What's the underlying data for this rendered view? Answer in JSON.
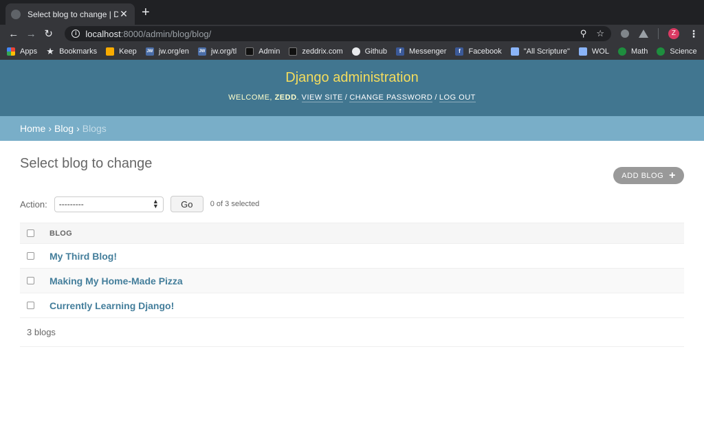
{
  "browser": {
    "tab_title": "Select blog to change | Django s",
    "tab_close": "✕",
    "new_tab": "+",
    "url_host": "localhost",
    "url_path": ":8000/admin/blog/blog/",
    "avatar_letter": "Z",
    "bookmarks": [
      {
        "label": "Apps",
        "icon": "apps-icon"
      },
      {
        "label": "Bookmarks",
        "icon": "star-icon"
      },
      {
        "label": "Keep",
        "icon": "keep-icon"
      },
      {
        "label": "jw.org/en",
        "icon": "jw-icon"
      },
      {
        "label": "jw.org/tl",
        "icon": "jw-icon"
      },
      {
        "label": "Admin",
        "icon": "admin-icon"
      },
      {
        "label": "zeddrix.com",
        "icon": "admin-icon"
      },
      {
        "label": "Github",
        "icon": "github-icon"
      },
      {
        "label": "Messenger",
        "icon": "facebook-icon"
      },
      {
        "label": "Facebook",
        "icon": "facebook-icon"
      },
      {
        "label": "\"All Scripture\"",
        "icon": "wol-icon"
      },
      {
        "label": "WOL",
        "icon": "wol-icon"
      },
      {
        "label": "Math",
        "icon": "khan-icon"
      },
      {
        "label": "Science",
        "icon": "khan-icon"
      }
    ],
    "bookmarks_more": "»"
  },
  "admin": {
    "brand": "Django administration",
    "welcome": "Welcome,",
    "user": "Zedd",
    "view_site": "View site",
    "change_password": "Change password",
    "log_out": "Log out"
  },
  "breadcrumbs": {
    "home": "Home",
    "blog": "Blog",
    "current": "Blogs",
    "separator": "›"
  },
  "page": {
    "title": "Select blog to change",
    "add_button": "Add blog",
    "action_label": "Action:",
    "action_selected": "---------",
    "go_button": "Go",
    "selected_count": "0 of 3 selected",
    "column_header": "Blog",
    "rows": [
      {
        "title": "My Third Blog!"
      },
      {
        "title": "Making My Home-Made Pizza"
      },
      {
        "title": "Currently Learning Django!"
      }
    ],
    "paginator": "3 blogs"
  }
}
